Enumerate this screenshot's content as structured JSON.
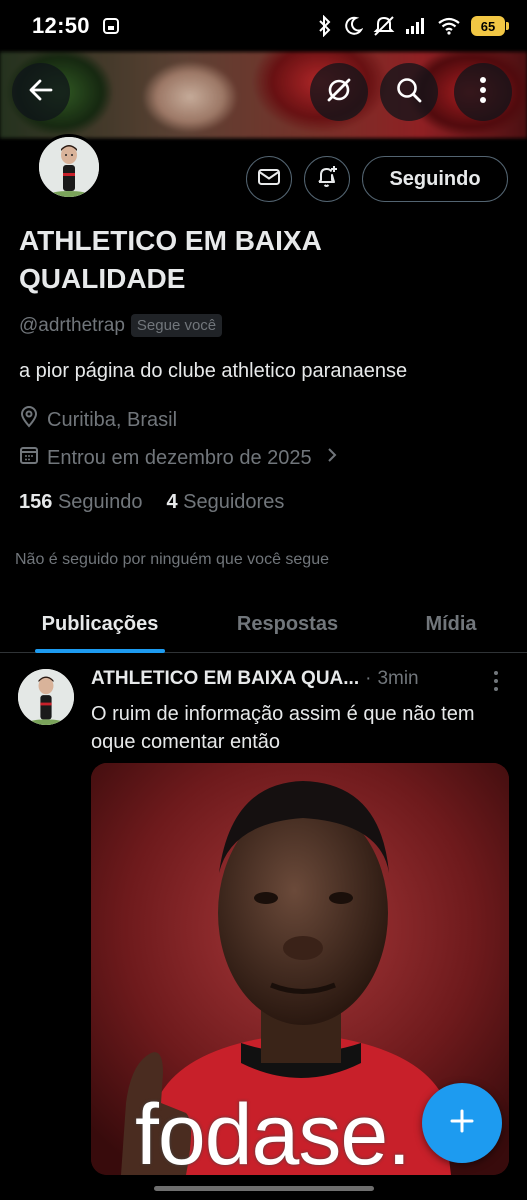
{
  "status_bar": {
    "time": "12:50",
    "battery_level": "65",
    "icons": [
      "screenshot-icon",
      "bluetooth-icon",
      "do-not-disturb-icon",
      "mute-icon",
      "signal-icon",
      "wifi-icon",
      "battery-icon"
    ],
    "battery_color": "#f2c744"
  },
  "toolbar": {
    "icons": [
      "back-arrow-icon",
      "grok-icon",
      "search-icon",
      "more-vertical-icon"
    ]
  },
  "profile": {
    "display_name": "ATHLETICO EM BAIXA QUALIDADE",
    "handle": "@adrthetrap",
    "follows_you_badge": "Segue você",
    "bio": "a pior página do clube athletico paranaense",
    "location": "Curitiba, Brasil",
    "joined": "Entrou em dezembro de 2025",
    "following_count": "156",
    "following_label": "Seguindo",
    "followers_count": "4",
    "followers_label": "Seguidores",
    "not_followed_notice": "Não é seguido por ninguém que você segue",
    "following_button": "Seguindo"
  },
  "tabs": [
    {
      "label": "Publicações",
      "active": true
    },
    {
      "label": "Respostas",
      "active": false
    },
    {
      "label": "Mídia",
      "active": false
    }
  ],
  "post": {
    "author_name": "ATHLETICO EM BAIXA QUA...",
    "separator": "·",
    "time": "3min",
    "text": "O ruim de informação assim é que não tem oque comentar então",
    "media_caption": "fodase."
  },
  "colors": {
    "accent": "#1d9bf0",
    "background": "#000000",
    "text_primary": "#e7e9ea",
    "text_secondary": "#71767b",
    "border": "#536471"
  }
}
